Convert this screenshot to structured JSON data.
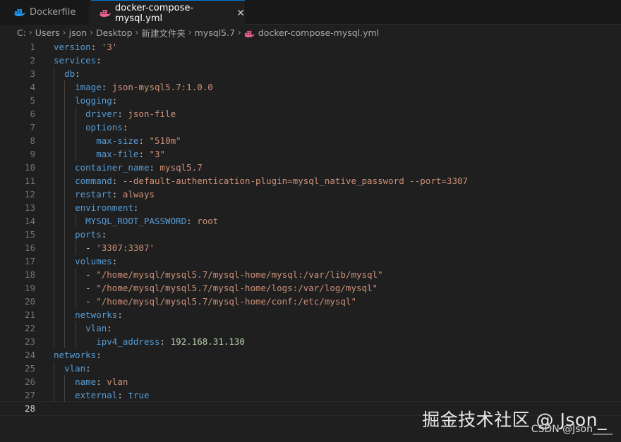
{
  "tabs": [
    {
      "label": "Dockerfile",
      "icon": "docker-icon",
      "active": false
    },
    {
      "label": "docker-compose-mysql.yml",
      "icon": "docker-icon",
      "active": true,
      "close": "✕"
    }
  ],
  "breadcrumb": [
    "C:",
    "Users",
    "json",
    "Desktop",
    "新建文件夹",
    "mysql5.7",
    "docker-compose-mysql.yml"
  ],
  "lines": [
    {
      "n": "1",
      "t": [
        [
          "k",
          "version"
        ],
        [
          "p",
          ": "
        ],
        [
          "s",
          "'3'"
        ]
      ]
    },
    {
      "n": "2",
      "t": [
        [
          "k",
          "services"
        ],
        [
          "p",
          ":"
        ]
      ]
    },
    {
      "n": "3",
      "t": [
        [
          "p",
          "  "
        ],
        [
          "k",
          "db"
        ],
        [
          "p",
          ":"
        ]
      ]
    },
    {
      "n": "4",
      "t": [
        [
          "p",
          "    "
        ],
        [
          "k",
          "image"
        ],
        [
          "p",
          ": "
        ],
        [
          "s",
          "json-mysql5.7:1.0.0"
        ]
      ]
    },
    {
      "n": "5",
      "t": [
        [
          "p",
          "    "
        ],
        [
          "k",
          "logging"
        ],
        [
          "p",
          ":"
        ]
      ]
    },
    {
      "n": "6",
      "t": [
        [
          "p",
          "      "
        ],
        [
          "k",
          "driver"
        ],
        [
          "p",
          ": "
        ],
        [
          "s",
          "json-file"
        ]
      ]
    },
    {
      "n": "7",
      "t": [
        [
          "p",
          "      "
        ],
        [
          "k",
          "options"
        ],
        [
          "p",
          ":"
        ]
      ]
    },
    {
      "n": "8",
      "t": [
        [
          "p",
          "        "
        ],
        [
          "k",
          "max-size"
        ],
        [
          "p",
          ": "
        ],
        [
          "s",
          "\"510m\""
        ]
      ]
    },
    {
      "n": "9",
      "t": [
        [
          "p",
          "        "
        ],
        [
          "k",
          "max-file"
        ],
        [
          "p",
          ": "
        ],
        [
          "s",
          "\"3\""
        ]
      ]
    },
    {
      "n": "10",
      "t": [
        [
          "p",
          "    "
        ],
        [
          "k",
          "container_name"
        ],
        [
          "p",
          ": "
        ],
        [
          "s",
          "mysql5.7"
        ]
      ]
    },
    {
      "n": "11",
      "t": [
        [
          "p",
          "    "
        ],
        [
          "k",
          "command"
        ],
        [
          "p",
          ": "
        ],
        [
          "s",
          "--default-authentication-plugin=mysql_native_password --port=3307"
        ]
      ]
    },
    {
      "n": "12",
      "t": [
        [
          "p",
          "    "
        ],
        [
          "k",
          "restart"
        ],
        [
          "p",
          ": "
        ],
        [
          "s",
          "always"
        ]
      ]
    },
    {
      "n": "13",
      "t": [
        [
          "p",
          "    "
        ],
        [
          "k",
          "environment"
        ],
        [
          "p",
          ":"
        ]
      ]
    },
    {
      "n": "14",
      "t": [
        [
          "p",
          "      "
        ],
        [
          "k",
          "MYSQL_ROOT_PASSWORD"
        ],
        [
          "p",
          ": "
        ],
        [
          "s",
          "root"
        ]
      ]
    },
    {
      "n": "15",
      "t": [
        [
          "p",
          "    "
        ],
        [
          "k",
          "ports"
        ],
        [
          "p",
          ":"
        ]
      ]
    },
    {
      "n": "16",
      "t": [
        [
          "p",
          "      - "
        ],
        [
          "s",
          "'3307:3307'"
        ]
      ]
    },
    {
      "n": "17",
      "t": [
        [
          "p",
          "    "
        ],
        [
          "k",
          "volumes"
        ],
        [
          "p",
          ":"
        ]
      ]
    },
    {
      "n": "18",
      "t": [
        [
          "p",
          "      - "
        ],
        [
          "s",
          "\"/home/mysql/mysql5.7/mysql-home/mysql:/var/lib/mysql\""
        ]
      ]
    },
    {
      "n": "19",
      "t": [
        [
          "p",
          "      - "
        ],
        [
          "s",
          "\"/home/mysql/mysql5.7/mysql-home/logs:/var/log/mysql\""
        ]
      ]
    },
    {
      "n": "20",
      "t": [
        [
          "p",
          "      - "
        ],
        [
          "s",
          "\"/home/mysql/mysql5.7/mysql-home/conf:/etc/mysql\""
        ]
      ]
    },
    {
      "n": "21",
      "t": [
        [
          "p",
          "    "
        ],
        [
          "k",
          "networks"
        ],
        [
          "p",
          ":"
        ]
      ]
    },
    {
      "n": "22",
      "t": [
        [
          "p",
          "      "
        ],
        [
          "k",
          "vlan"
        ],
        [
          "p",
          ":"
        ]
      ]
    },
    {
      "n": "23",
      "t": [
        [
          "p",
          "        "
        ],
        [
          "k",
          "ipv4_address"
        ],
        [
          "p",
          ": "
        ],
        [
          "n",
          "192.168.31.130"
        ]
      ]
    },
    {
      "n": "24",
      "t": [
        [
          "k",
          "networks"
        ],
        [
          "p",
          ":"
        ]
      ]
    },
    {
      "n": "25",
      "t": [
        [
          "p",
          "  "
        ],
        [
          "k",
          "vlan"
        ],
        [
          "p",
          ":"
        ]
      ]
    },
    {
      "n": "26",
      "t": [
        [
          "p",
          "    "
        ],
        [
          "k",
          "name"
        ],
        [
          "p",
          ": "
        ],
        [
          "s",
          "vlan"
        ]
      ]
    },
    {
      "n": "27",
      "t": [
        [
          "p",
          "    "
        ],
        [
          "k",
          "external"
        ],
        [
          "p",
          ": "
        ],
        [
          "b",
          "true"
        ]
      ]
    },
    {
      "n": "28",
      "t": []
    }
  ],
  "watermark": "掘金技术社区 @ Json_",
  "csdn": "CSDN @Json____",
  "colors": {
    "key": "#569cd6",
    "string": "#ce9178",
    "number": "#b5cea8",
    "accent": "#0078d4",
    "docker_blue": "#2496ed",
    "docker_pink": "#f06292"
  }
}
